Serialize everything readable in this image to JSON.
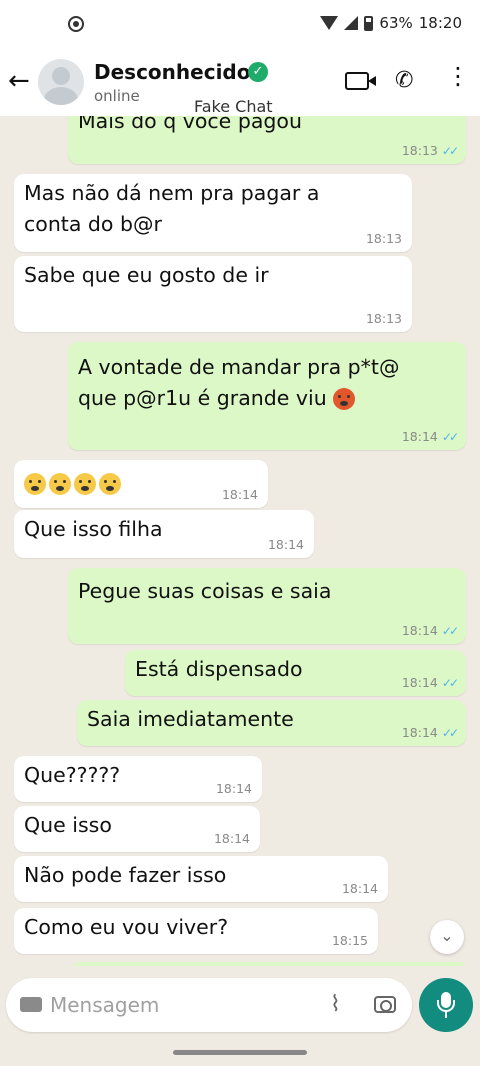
{
  "status_bar": {
    "battery": "63%",
    "time": "18:20"
  },
  "header": {
    "contact_name": "Desconhecido",
    "contact_status": "online",
    "app_label": "Fake Chat"
  },
  "composer": {
    "placeholder": "Mensagem"
  },
  "messages": [
    {
      "direction": "out",
      "text": "Mais do q voce pagou",
      "time": "18:13",
      "ticks": "✓✓"
    },
    {
      "direction": "in",
      "text": "Mas não dá nem pra pagar a",
      "text2": "conta do b@r",
      "time": "18:13"
    },
    {
      "direction": "in",
      "text": "Sabe que eu gosto de ir",
      "time": "18:13"
    },
    {
      "direction": "out",
      "text": "A vontade de mandar pra p*t@",
      "text2": "que p@r1u é grande viu",
      "time": "18:14",
      "ticks": "✓✓"
    },
    {
      "direction": "in",
      "text": "",
      "time": "18:14"
    },
    {
      "direction": "in",
      "text": "Que isso filha",
      "time": "18:14"
    },
    {
      "direction": "out",
      "text": "Pegue suas coisas e saia",
      "time": "18:14",
      "ticks": "✓✓"
    },
    {
      "direction": "out",
      "text": "Está dispensado",
      "time": "18:14",
      "ticks": "✓✓"
    },
    {
      "direction": "out",
      "text": "Saia imediatamente",
      "time": "18:14",
      "ticks": "✓✓"
    },
    {
      "direction": "in",
      "text": "Que?????",
      "time": "18:14"
    },
    {
      "direction": "in",
      "text": "Que isso",
      "time": "18:14"
    },
    {
      "direction": "in",
      "text": "Não pode fazer isso",
      "time": "18:14"
    },
    {
      "direction": "in",
      "text": "Como eu vou viver?",
      "time": "18:15"
    }
  ],
  "colors": {
    "incoming": "#ffffff",
    "outgoing": "#dcf8c6",
    "accent": "#128c7e",
    "read_ticks": "#4fb6ec"
  },
  "icons": [
    "back-arrow-icon",
    "verified-icon",
    "video-call-icon",
    "phone-icon",
    "more-menu-icon",
    "scroll-down-icon",
    "keyboard-icon",
    "attach-icon",
    "camera-icon",
    "mic-icon"
  ]
}
